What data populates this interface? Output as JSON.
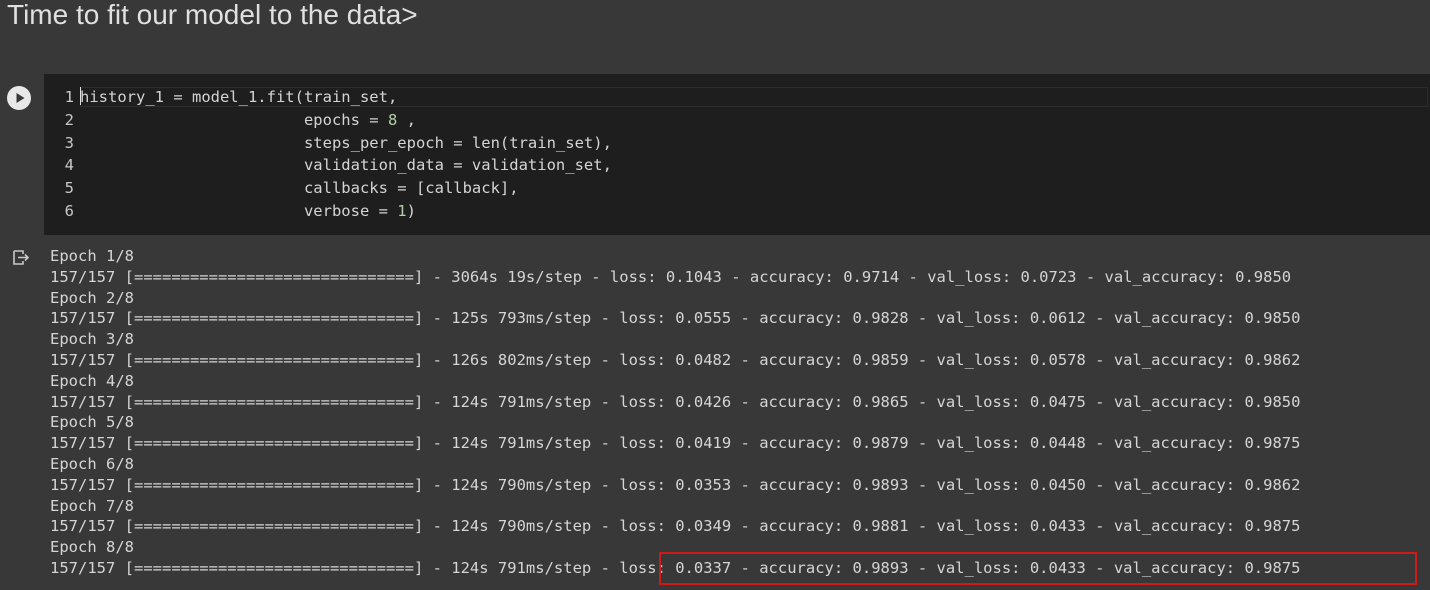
{
  "text_cell": {
    "heading": "Time to fit our model to the data>"
  },
  "code_cell": {
    "run_icon": "play-icon",
    "lines": [
      {
        "num": "1",
        "pre": "history_1 = model_1.fit(train_set,",
        "numval": "",
        "post": ""
      },
      {
        "num": "2",
        "pre": "                        epochs = ",
        "numval": "8",
        "post": " ,"
      },
      {
        "num": "3",
        "pre": "                        steps_per_epoch = len(train_set),",
        "numval": "",
        "post": ""
      },
      {
        "num": "4",
        "pre": "                        validation_data = validation_set,",
        "numval": "",
        "post": ""
      },
      {
        "num": "5",
        "pre": "                        callbacks = [callback],",
        "numval": "",
        "post": ""
      },
      {
        "num": "6",
        "pre": "                        verbose = ",
        "numval": "1",
        "post": ")"
      }
    ]
  },
  "output": {
    "icon": "output-arrow-icon",
    "lines": [
      "Epoch 1/8",
      "157/157 [==============================] - 3064s 19s/step - loss: 0.1043 - accuracy: 0.9714 - val_loss: 0.0723 - val_accuracy: 0.9850",
      "Epoch 2/8",
      "157/157 [==============================] - 125s 793ms/step - loss: 0.0555 - accuracy: 0.9828 - val_loss: 0.0612 - val_accuracy: 0.9850",
      "Epoch 3/8",
      "157/157 [==============================] - 126s 802ms/step - loss: 0.0482 - accuracy: 0.9859 - val_loss: 0.0578 - val_accuracy: 0.9862",
      "Epoch 4/8",
      "157/157 [==============================] - 124s 791ms/step - loss: 0.0426 - accuracy: 0.9865 - val_loss: 0.0475 - val_accuracy: 0.9850",
      "Epoch 5/8",
      "157/157 [==============================] - 124s 791ms/step - loss: 0.0419 - accuracy: 0.9879 - val_loss: 0.0448 - val_accuracy: 0.9875",
      "Epoch 6/8",
      "157/157 [==============================] - 124s 790ms/step - loss: 0.0353 - accuracy: 0.9893 - val_loss: 0.0450 - val_accuracy: 0.9862",
      "Epoch 7/8",
      "157/157 [==============================] - 124s 790ms/step - loss: 0.0349 - accuracy: 0.9881 - val_loss: 0.0433 - val_accuracy: 0.9875",
      "Epoch 8/8",
      "157/157 [==============================] - 124s 791ms/step - loss: 0.0337 - accuracy: 0.9893 - val_loss: 0.0433 - val_accuracy: 0.9875"
    ]
  },
  "colors": {
    "highlight": "#d01919",
    "number_literal": "#b5cea8"
  }
}
